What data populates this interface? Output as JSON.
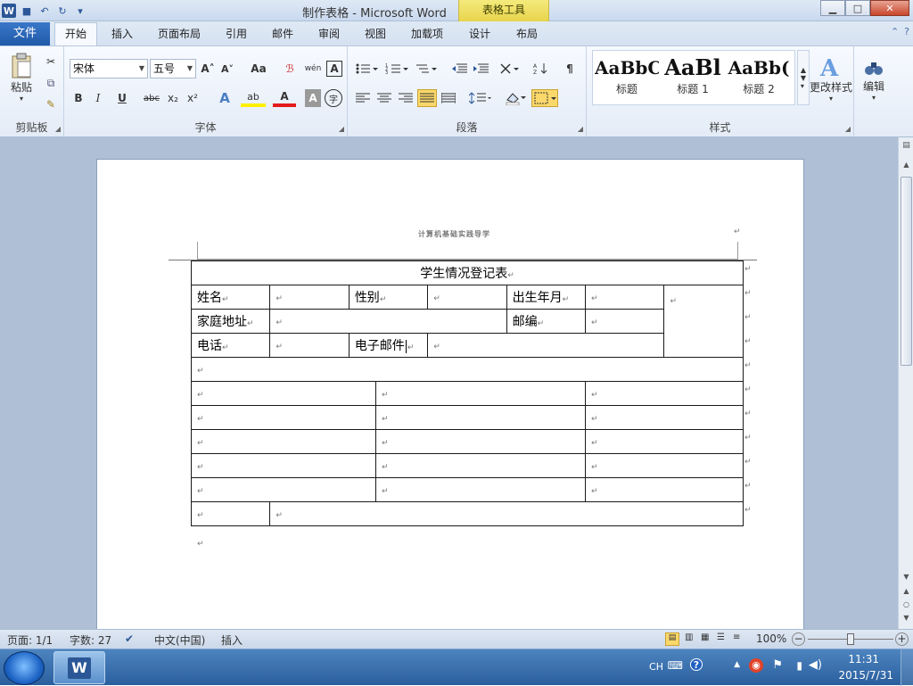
{
  "window": {
    "title": "制作表格 - Microsoft Word",
    "context_tab": "表格工具",
    "min_glyph": "▁",
    "max_glyph": "□",
    "close_glyph": "✕"
  },
  "qat": {
    "word_logo": "W",
    "save_glyph": "■",
    "undo_glyph": "↶",
    "redo_glyph": "↻",
    "more_glyph": "▾"
  },
  "ribbon_tabs": {
    "file": "文件",
    "items": [
      "开始",
      "插入",
      "页面布局",
      "引用",
      "邮件",
      "审阅",
      "视图",
      "加载项",
      "设计",
      "布局"
    ],
    "help_glyph": "?",
    "collapse_glyph": "⌃"
  },
  "clipboard": {
    "paste": "粘贴",
    "label": "剪贴板",
    "cut_glyph": "✂",
    "copy_glyph": "⧉",
    "format_glyph": "✎"
  },
  "font": {
    "name": "宋体",
    "size": "五号",
    "grow": "A˄",
    "shrink": "A˅",
    "case": "Aa",
    "clear": "ℬ",
    "phonetic": "wén",
    "border_char": "A",
    "bold": "B",
    "italic": "I",
    "underline": "U",
    "strike": "abc",
    "sub": "x₂",
    "sup": "x²",
    "effects": "A",
    "highlight": "ab",
    "color": "A",
    "shade": "A",
    "enclose": "字",
    "label": "字体"
  },
  "paragraph": {
    "label": "段落"
  },
  "styles": {
    "items": [
      {
        "sample": "AaBbC",
        "name": "标题"
      },
      {
        "sample": "AaBl",
        "name": "标题 1"
      },
      {
        "sample": "AaBb(",
        "name": "标题 2"
      }
    ],
    "change": "更改样式",
    "label": "样式"
  },
  "editing": {
    "label": "编辑"
  },
  "document": {
    "header_text": "计算机基础实践导学",
    "mark": "↵",
    "table": {
      "title": "学生情况登记表",
      "name_label": "姓名",
      "gender_label": "性别",
      "birth_label": "出生年月",
      "address_label": "家庭地址",
      "zip_label": "邮编",
      "phone_label": "电话",
      "email_label": "电子邮件"
    }
  },
  "statusbar": {
    "page": "页面: 1/1",
    "words": "字数: 27",
    "language": "中文(中国)",
    "mode": "插入",
    "zoom": "100%",
    "zoom_out": "−",
    "zoom_in": "+"
  },
  "taskbar": {
    "app_glyph": "W",
    "ime": "CH",
    "time": "11:31",
    "date": "2015/7/31"
  }
}
